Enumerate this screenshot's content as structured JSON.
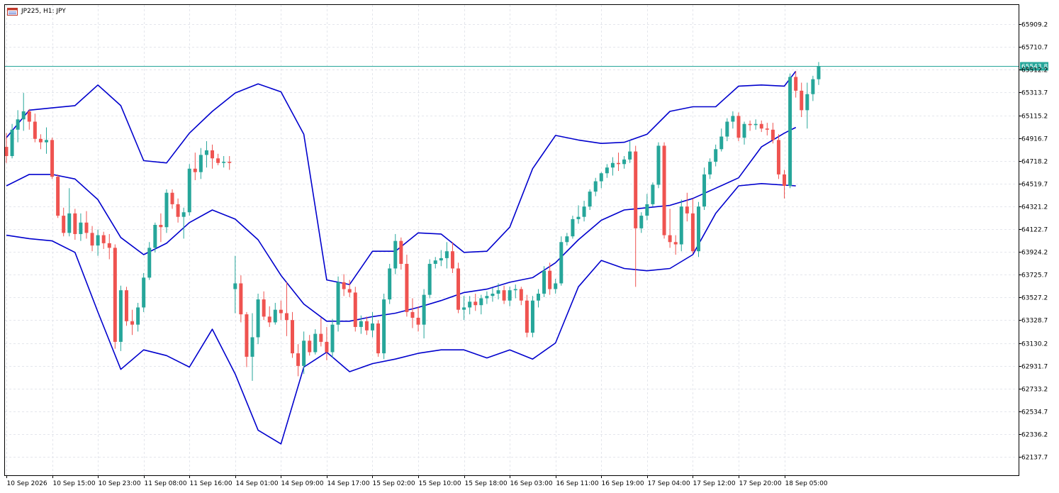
{
  "window": {
    "title": "JP225, H1:  JPY"
  },
  "colors": {
    "background": "#ffffff",
    "frame": "#000000",
    "grid": "#e4e6ec",
    "bull": "#26a69a",
    "bear": "#ef5350",
    "bands": "#0000cd",
    "price_line": "#26a69a"
  },
  "icons": {
    "title": "chart-window-icon"
  },
  "chart_data": {
    "type": "candlestick",
    "symbol": "JP225",
    "timeframe": "H1",
    "currency": "JPY",
    "current_price_label": "65543.8",
    "current_price": 65543.8,
    "ylim": [
      61976.7,
      66077.5
    ],
    "grid": true,
    "y_ticks": [
      {
        "value": 65909.2,
        "label": "65909.2"
      },
      {
        "value": 65710.7,
        "label": "65710.7"
      },
      {
        "value": 65512.2,
        "label": "65512.2"
      },
      {
        "value": 65313.7,
        "label": "65313.7"
      },
      {
        "value": 65115.2,
        "label": "65115.2"
      },
      {
        "value": 64916.7,
        "label": "64916.7"
      },
      {
        "value": 64718.2,
        "label": "64718.2"
      },
      {
        "value": 64519.7,
        "label": "64519.7"
      },
      {
        "value": 64321.2,
        "label": "64321.2"
      },
      {
        "value": 64122.7,
        "label": "64122.7"
      },
      {
        "value": 63924.2,
        "label": "63924.2"
      },
      {
        "value": 63725.7,
        "label": "63725.7"
      },
      {
        "value": 63527.2,
        "label": "63527.2"
      },
      {
        "value": 63328.7,
        "label": "63328.7"
      },
      {
        "value": 63130.2,
        "label": "63130.2"
      },
      {
        "value": 62931.7,
        "label": "62931.7"
      },
      {
        "value": 62733.2,
        "label": "62733.2"
      },
      {
        "value": 62534.7,
        "label": "62534.7"
      },
      {
        "value": 62336.2,
        "label": "62336.2"
      },
      {
        "value": 62137.7,
        "label": "62137.7"
      }
    ],
    "x_ticks": [
      {
        "index": 0,
        "label": "10 Sep 2026"
      },
      {
        "index": 8,
        "label": "10 Sep 15:00"
      },
      {
        "index": 16,
        "label": "10 Sep 23:00"
      },
      {
        "index": 24,
        "label": "11 Sep 08:00"
      },
      {
        "index": 32,
        "label": "11 Sep 16:00"
      },
      {
        "index": 40,
        "label": "14 Sep 01:00"
      },
      {
        "index": 48,
        "label": "14 Sep 09:00"
      },
      {
        "index": 56,
        "label": "14 Sep 17:00"
      },
      {
        "index": 64,
        "label": "15 Sep 02:00"
      },
      {
        "index": 72,
        "label": "15 Sep 10:00"
      },
      {
        "index": 80,
        "label": "15 Sep 18:00"
      },
      {
        "index": 88,
        "label": "16 Sep 03:00"
      },
      {
        "index": 96,
        "label": "16 Sep 11:00"
      },
      {
        "index": 104,
        "label": "16 Sep 19:00"
      },
      {
        "index": 112,
        "label": "17 Sep 04:00"
      },
      {
        "index": 120,
        "label": "17 Sep 12:00"
      },
      {
        "index": 128,
        "label": "17 Sep 20:00"
      },
      {
        "index": 136,
        "label": "18 Sep 05:00"
      }
    ],
    "candles": [
      [
        64840,
        64960,
        64700,
        64760
      ],
      [
        64760,
        65040,
        64740,
        64990
      ],
      [
        64990,
        65160,
        64880,
        65080
      ],
      [
        65080,
        65310,
        64980,
        65150
      ],
      [
        65150,
        65170,
        64990,
        65060
      ],
      [
        65060,
        65130,
        64880,
        64910
      ],
      [
        64910,
        64950,
        64820,
        64880
      ],
      [
        64880,
        65010,
        64780,
        64900
      ],
      [
        64900,
        64920,
        64560,
        64580
      ],
      [
        64580,
        64600,
        64220,
        64240
      ],
      [
        64240,
        64310,
        64060,
        64090
      ],
      [
        64090,
        64480,
        64060,
        64260
      ],
      [
        64260,
        64300,
        64030,
        64080
      ],
      [
        64080,
        64260,
        64020,
        64180
      ],
      [
        64180,
        64280,
        64040,
        64090
      ],
      [
        64090,
        64150,
        63930,
        63980
      ],
      [
        63980,
        64120,
        63890,
        64070
      ],
      [
        64070,
        64100,
        63950,
        64000
      ],
      [
        64000,
        64080,
        63860,
        63960
      ],
      [
        63960,
        63990,
        63080,
        63140
      ],
      [
        63140,
        63630,
        63060,
        63590
      ],
      [
        63590,
        63620,
        63280,
        63320
      ],
      [
        63320,
        63420,
        63200,
        63290
      ],
      [
        63290,
        63480,
        63230,
        63440
      ],
      [
        63440,
        63740,
        63400,
        63700
      ],
      [
        63700,
        64010,
        63680,
        63960
      ],
      [
        63960,
        64180,
        63920,
        64160
      ],
      [
        64160,
        64260,
        64010,
        64140
      ],
      [
        64140,
        64470,
        64090,
        64440
      ],
      [
        64440,
        64470,
        64300,
        64340
      ],
      [
        64340,
        64390,
        64180,
        64230
      ],
      [
        64230,
        64310,
        64040,
        64270
      ],
      [
        64270,
        64690,
        64240,
        64650
      ],
      [
        64650,
        64790,
        64550,
        64620
      ],
      [
        64620,
        64830,
        64560,
        64770
      ],
      [
        64770,
        64890,
        64660,
        64810
      ],
      [
        64810,
        64860,
        64650,
        64740
      ],
      [
        64740,
        64780,
        64680,
        64700
      ],
      [
        64700,
        64760,
        64660,
        64710
      ],
      [
        64710,
        64760,
        64640,
        64700
      ],
      [
        63600,
        63890,
        63390,
        63650
      ],
      [
        63650,
        63720,
        63310,
        63380
      ],
      [
        63380,
        63400,
        62920,
        63010
      ],
      [
        63010,
        63390,
        62800,
        63180
      ],
      [
        63180,
        63560,
        63120,
        63510
      ],
      [
        63510,
        63580,
        63330,
        63360
      ],
      [
        63360,
        63450,
        63270,
        63310
      ],
      [
        63310,
        63480,
        63290,
        63420
      ],
      [
        63420,
        63500,
        63330,
        63390
      ],
      [
        63390,
        63660,
        63190,
        63330
      ],
      [
        63330,
        63400,
        63000,
        63040
      ],
      [
        63040,
        63120,
        62840,
        62930
      ],
      [
        62930,
        63230,
        62860,
        63150
      ],
      [
        63150,
        63200,
        63020,
        63050
      ],
      [
        63050,
        63250,
        63030,
        63210
      ],
      [
        63210,
        63350,
        63100,
        63140
      ],
      [
        63140,
        63270,
        62980,
        63050
      ],
      [
        63050,
        63340,
        63000,
        63290
      ],
      [
        63290,
        63710,
        63230,
        63660
      ],
      [
        63660,
        63730,
        63540,
        63600
      ],
      [
        63600,
        63680,
        63530,
        63570
      ],
      [
        63570,
        63620,
        63230,
        63270
      ],
      [
        63270,
        63370,
        63210,
        63320
      ],
      [
        63320,
        63360,
        63200,
        63240
      ],
      [
        63240,
        63400,
        63180,
        63300
      ],
      [
        63300,
        63330,
        63010,
        63040
      ],
      [
        63040,
        63560,
        62990,
        63510
      ],
      [
        63510,
        63820,
        63470,
        63780
      ],
      [
        63780,
        64080,
        63730,
        64020
      ],
      [
        64020,
        64050,
        63770,
        63820
      ],
      [
        63820,
        63900,
        63360,
        63400
      ],
      [
        63400,
        63520,
        63260,
        63350
      ],
      [
        63350,
        63450,
        63230,
        63290
      ],
      [
        63290,
        63600,
        63170,
        63550
      ],
      [
        63550,
        63860,
        63520,
        63820
      ],
      [
        63820,
        63880,
        63780,
        63850
      ],
      [
        63850,
        63940,
        63800,
        63870
      ],
      [
        63870,
        64010,
        63780,
        63930
      ],
      [
        63930,
        64010,
        63740,
        63780
      ],
      [
        63780,
        63830,
        63390,
        63420
      ],
      [
        63420,
        63540,
        63330,
        63440
      ],
      [
        63440,
        63540,
        63380,
        63490
      ],
      [
        63490,
        63560,
        63410,
        63460
      ],
      [
        63460,
        63550,
        63380,
        63520
      ],
      [
        63520,
        63580,
        63470,
        63540
      ],
      [
        63540,
        63610,
        63490,
        63560
      ],
      [
        63560,
        63650,
        63510,
        63590
      ],
      [
        63590,
        63630,
        63470,
        63500
      ],
      [
        63500,
        63620,
        63450,
        63590
      ],
      [
        63590,
        63640,
        63520,
        63600
      ],
      [
        63600,
        63620,
        63460,
        63500
      ],
      [
        63500,
        63550,
        63180,
        63220
      ],
      [
        63220,
        63540,
        63180,
        63500
      ],
      [
        63500,
        63600,
        63440,
        63560
      ],
      [
        63560,
        63800,
        63530,
        63760
      ],
      [
        63760,
        63830,
        63550,
        63600
      ],
      [
        63600,
        63690,
        63560,
        63650
      ],
      [
        63650,
        64060,
        63630,
        64010
      ],
      [
        64010,
        64090,
        63980,
        64060
      ],
      [
        64060,
        64240,
        64040,
        64210
      ],
      [
        64210,
        64330,
        64170,
        64230
      ],
      [
        64230,
        64370,
        64190,
        64320
      ],
      [
        64320,
        64470,
        64290,
        64450
      ],
      [
        64450,
        64570,
        64410,
        64540
      ],
      [
        64540,
        64620,
        64480,
        64610
      ],
      [
        64610,
        64690,
        64570,
        64660
      ],
      [
        64660,
        64750,
        64590,
        64700
      ],
      [
        64700,
        64790,
        64630,
        64690
      ],
      [
        64690,
        64760,
        64650,
        64730
      ],
      [
        64730,
        64890,
        64700,
        64800
      ],
      [
        64800,
        64850,
        63620,
        64130
      ],
      [
        64130,
        64270,
        64090,
        64240
      ],
      [
        64240,
        64430,
        64200,
        64340
      ],
      [
        64340,
        64530,
        64320,
        64510
      ],
      [
        64510,
        64880,
        64480,
        64850
      ],
      [
        64850,
        64880,
        64040,
        64070
      ],
      [
        64070,
        64300,
        63960,
        64010
      ],
      [
        64010,
        64070,
        63900,
        63990
      ],
      [
        63990,
        64380,
        63930,
        64320
      ],
      [
        64320,
        64440,
        64190,
        64260
      ],
      [
        64260,
        64390,
        63910,
        63930
      ],
      [
        63930,
        64360,
        63880,
        64320
      ],
      [
        64320,
        64660,
        64290,
        64600
      ],
      [
        64600,
        64740,
        64560,
        64710
      ],
      [
        64710,
        64860,
        64670,
        64820
      ],
      [
        64820,
        65000,
        64800,
        64930
      ],
      [
        64930,
        65090,
        64890,
        65060
      ],
      [
        65060,
        65150,
        65000,
        65110
      ],
      [
        65110,
        65140,
        64890,
        64920
      ],
      [
        64920,
        65060,
        64860,
        65040
      ],
      [
        65040,
        65070,
        64980,
        65030
      ],
      [
        65030,
        65080,
        64990,
        65040
      ],
      [
        65040,
        65070,
        64970,
        65000
      ],
      [
        65000,
        65050,
        64940,
        64990
      ],
      [
        64990,
        65050,
        64870,
        64900
      ],
      [
        64900,
        64950,
        64560,
        64600
      ],
      [
        64600,
        64640,
        64390,
        64500
      ],
      [
        64500,
        65480,
        64480,
        65450
      ],
      [
        65450,
        65500,
        65270,
        65330
      ],
      [
        65330,
        65400,
        65100,
        65160
      ],
      [
        65160,
        65400,
        65000,
        65300
      ],
      [
        65300,
        65460,
        65240,
        65430
      ],
      [
        65430,
        65580,
        65380,
        65543.8
      ]
    ],
    "bands": {
      "upper": [
        [
          0,
          64920
        ],
        [
          4,
          65160
        ],
        [
          8,
          65180
        ],
        [
          12,
          65200
        ],
        [
          16,
          65380
        ],
        [
          20,
          65200
        ],
        [
          24,
          64720
        ],
        [
          28,
          64700
        ],
        [
          32,
          64960
        ],
        [
          36,
          65150
        ],
        [
          40,
          65310
        ],
        [
          44,
          65390
        ],
        [
          48,
          65320
        ],
        [
          52,
          64950
        ],
        [
          56,
          63680
        ],
        [
          60,
          63640
        ],
        [
          64,
          63930
        ],
        [
          68,
          63930
        ],
        [
          72,
          64090
        ],
        [
          76,
          64080
        ],
        [
          80,
          63920
        ],
        [
          84,
          63930
        ],
        [
          88,
          64140
        ],
        [
          92,
          64650
        ],
        [
          96,
          64940
        ],
        [
          100,
          64900
        ],
        [
          104,
          64870
        ],
        [
          108,
          64880
        ],
        [
          112,
          64950
        ],
        [
          116,
          65150
        ],
        [
          120,
          65190
        ],
        [
          124,
          65190
        ],
        [
          128,
          65370
        ],
        [
          132,
          65380
        ],
        [
          136,
          65370
        ],
        [
          138,
          65500
        ]
      ],
      "middle": [
        [
          0,
          64500
        ],
        [
          4,
          64600
        ],
        [
          8,
          64600
        ],
        [
          12,
          64560
        ],
        [
          16,
          64380
        ],
        [
          20,
          64050
        ],
        [
          24,
          63900
        ],
        [
          28,
          64000
        ],
        [
          32,
          64180
        ],
        [
          36,
          64290
        ],
        [
          40,
          64210
        ],
        [
          44,
          64030
        ],
        [
          48,
          63720
        ],
        [
          52,
          63470
        ],
        [
          56,
          63320
        ],
        [
          60,
          63320
        ],
        [
          64,
          63360
        ],
        [
          68,
          63390
        ],
        [
          72,
          63440
        ],
        [
          76,
          63500
        ],
        [
          80,
          63570
        ],
        [
          84,
          63600
        ],
        [
          88,
          63660
        ],
        [
          92,
          63700
        ],
        [
          96,
          63830
        ],
        [
          100,
          64030
        ],
        [
          104,
          64200
        ],
        [
          108,
          64290
        ],
        [
          112,
          64310
        ],
        [
          116,
          64330
        ],
        [
          120,
          64390
        ],
        [
          124,
          64480
        ],
        [
          128,
          64570
        ],
        [
          132,
          64840
        ],
        [
          136,
          64960
        ],
        [
          138,
          65010
        ]
      ],
      "lower": [
        [
          0,
          64070
        ],
        [
          4,
          64040
        ],
        [
          8,
          64020
        ],
        [
          12,
          63920
        ],
        [
          16,
          63400
        ],
        [
          20,
          62900
        ],
        [
          24,
          63070
        ],
        [
          28,
          63020
        ],
        [
          32,
          62920
        ],
        [
          36,
          63250
        ],
        [
          40,
          62860
        ],
        [
          44,
          62370
        ],
        [
          48,
          62250
        ],
        [
          52,
          62920
        ],
        [
          56,
          63050
        ],
        [
          60,
          62880
        ],
        [
          64,
          62950
        ],
        [
          68,
          62990
        ],
        [
          72,
          63040
        ],
        [
          76,
          63070
        ],
        [
          80,
          63070
        ],
        [
          84,
          63000
        ],
        [
          88,
          63070
        ],
        [
          92,
          62990
        ],
        [
          96,
          63130
        ],
        [
          100,
          63620
        ],
        [
          104,
          63850
        ],
        [
          108,
          63780
        ],
        [
          112,
          63760
        ],
        [
          116,
          63780
        ],
        [
          120,
          63900
        ],
        [
          124,
          64260
        ],
        [
          128,
          64500
        ],
        [
          132,
          64520
        ],
        [
          138,
          64500
        ]
      ]
    }
  }
}
